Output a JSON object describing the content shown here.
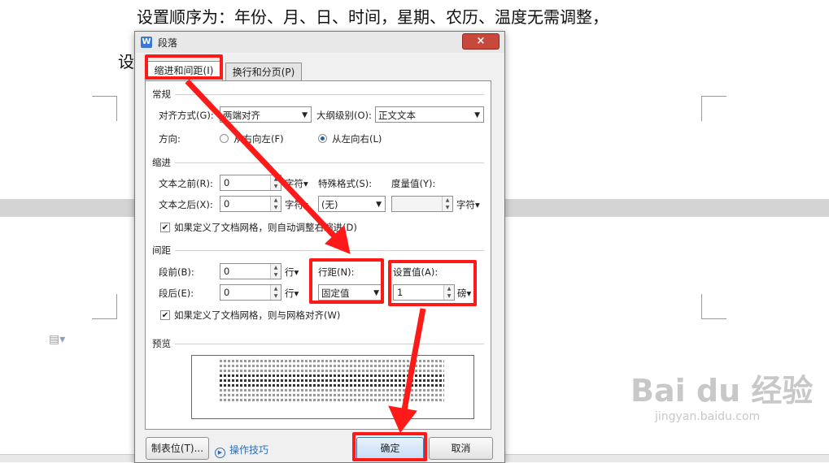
{
  "document": {
    "line1": "设置顺序为：年份、月、日、时间，星期、农历、温度无需调整，",
    "line2": "设"
  },
  "watermark": {
    "big": "Bai du 经验",
    "small": "jingyan.baidu.com"
  },
  "dialog": {
    "logo": "W",
    "title": "段落",
    "close": "×",
    "tabs": [
      {
        "label": "缩进和间距(I)",
        "active": true
      },
      {
        "label": "换行和分页(P)",
        "active": false
      }
    ],
    "general": {
      "section": "常规",
      "align_label": "对齐方式(G):",
      "align_value": "两端对齐",
      "outline_label": "大纲级别(O):",
      "outline_value": "正文文本",
      "direction_label": "方向:",
      "rtl_label": "从右向左(F)",
      "ltr_label": "从左向右(L)"
    },
    "indent": {
      "section": "缩进",
      "before_label": "文本之前(R):",
      "before_value": "0",
      "before_unit": "字符▾",
      "after_label": "文本之后(X):",
      "after_value": "0",
      "after_unit": "字符▾",
      "special_label": "特殊格式(S):",
      "special_value": "(无)",
      "measure_label": "度量值(Y):",
      "measure_value": "",
      "measure_unit": "字符▾",
      "auto_adjust": "如果定义了文档网格，则自动调整右缩进(D)"
    },
    "spacing": {
      "section": "间距",
      "before_label": "段前(B):",
      "before_value": "0",
      "before_unit": "行▾",
      "after_label": "段后(E):",
      "after_value": "0",
      "after_unit": "行▾",
      "line_label": "行距(N):",
      "line_value": "固定值",
      "set_label": "设置值(A):",
      "set_value": "1",
      "set_unit": "磅▾",
      "snap_grid": "如果定义了文档网格，则与网格对齐(W)"
    },
    "preview": {
      "section": "预览"
    },
    "buttons": {
      "tabs_stop": "制表位(T)...",
      "tips": "操作技巧",
      "ok": "确定",
      "cancel": "取消"
    }
  },
  "annotation_color": "#ff1a1a"
}
